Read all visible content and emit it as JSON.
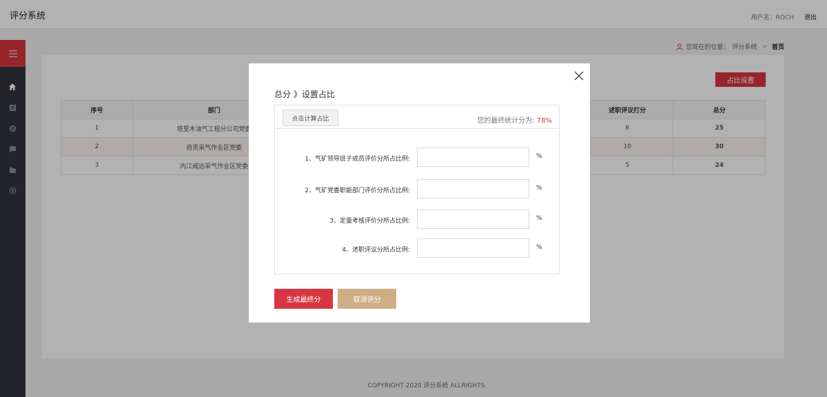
{
  "header": {
    "app_title": "评分系统",
    "user_label": "用户名：ROCH",
    "logout_label": "退出"
  },
  "sidebar": {
    "icons": [
      "menu-icon",
      "home-icon",
      "document-icon",
      "target-icon",
      "chat-icon",
      "folder-icon",
      "gear-icon"
    ]
  },
  "breadcrumb": {
    "prefix": "您现在的位置：",
    "parent": "评分系统",
    "separator": ">",
    "current": "首页"
  },
  "main": {
    "ratio_button": "占比设置",
    "table": {
      "headers": [
        "序号",
        "部门",
        "述职评议打分",
        "总分"
      ],
      "rows": [
        {
          "index": "1",
          "dept": "塔里木油气工程分公司党委",
          "score": "6",
          "total": "25"
        },
        {
          "index": "2",
          "dept": "自贡采气作业区党委",
          "score": "10",
          "total": "30"
        },
        {
          "index": "3",
          "dept": "内江威远采气作业区党委",
          "score": "5",
          "total": "24"
        }
      ]
    }
  },
  "footer": {
    "copyright": "COPYRIGHT 2020 评分系统 ALLRIGHTS"
  },
  "modal": {
    "title": "总分 》设置占比",
    "calc_button": "点击计算占比",
    "score_label": "您的最终统计分为:",
    "score_value": "78%",
    "fields": [
      {
        "label": "1、气矿领导班子成员评价分所占比例:",
        "value": "",
        "unit": "%"
      },
      {
        "label": "2、气矿党委职能部门评价分所占比例:",
        "value": "",
        "unit": "%"
      },
      {
        "label": "3、定量考核评价分所占比例:",
        "value": "",
        "unit": "%"
      },
      {
        "label": "4、述职评议分所占比例:",
        "value": "",
        "unit": "%"
      }
    ],
    "generate_button": "生成最终分",
    "cancel_button": "取消评分"
  },
  "colors": {
    "accent": "#d73540",
    "sidebar": "#31343b",
    "cancel": "#cfae86"
  }
}
